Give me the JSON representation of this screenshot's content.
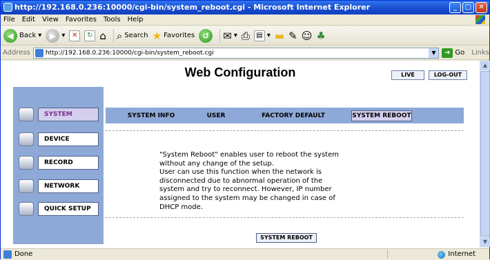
{
  "window": {
    "title": "http://192.168.0.236:10000/cgi-bin/system_reboot.cgi - Microsoft Internet Explorer",
    "controls": [
      "_",
      "□",
      "✕"
    ]
  },
  "menu": [
    "File",
    "Edit",
    "View",
    "Favorites",
    "Tools",
    "Help"
  ],
  "toolbar": {
    "back_label": "Back",
    "search_label": "Search",
    "favorites_label": "Favorites"
  },
  "address": {
    "label": "Address",
    "url": "http://192.168.0.236:10000/cgi-bin/system_reboot.cgi",
    "go_label": "Go",
    "links_label": "Links"
  },
  "page": {
    "title": "Web Configuration",
    "live_label": "LIVE",
    "logout_label": "LOG-OUT"
  },
  "sidebar": {
    "items": [
      {
        "label": "SYSTEM",
        "icon": "system-icon",
        "active": true
      },
      {
        "label": "DEVICE",
        "icon": "device-icon",
        "active": false
      },
      {
        "label": "RECORD",
        "icon": "record-icon",
        "active": false
      },
      {
        "label": "NETWORK",
        "icon": "network-icon",
        "active": false
      },
      {
        "label": "QUICK SETUP",
        "icon": "quick-setup-icon",
        "active": false
      }
    ]
  },
  "tabs": [
    {
      "label": "SYSTEM INFO",
      "active": false
    },
    {
      "label": "USER",
      "active": false
    },
    {
      "label": "FACTORY DEFAULT",
      "active": false
    },
    {
      "label": "SYSTEM REBOOT",
      "active": true
    }
  ],
  "description": {
    "lines": [
      "\"System Reboot\" enables user to reboot the system",
      "without any change of the setup.",
      "User can use this function when the network is",
      "disconnected due to abnormal operation of the",
      "system and try to reconnect. However, IP number",
      "assigned to the system may be changed in case of",
      "DHCP mode."
    ]
  },
  "reboot_button": "SYSTEM REBOOT",
  "status": {
    "text": "Done",
    "zone": "Internet"
  },
  "colors": {
    "panel_blue": "#8ea9d8",
    "active_tab": "#d4cfee",
    "active_text": "#7a2a8c"
  }
}
